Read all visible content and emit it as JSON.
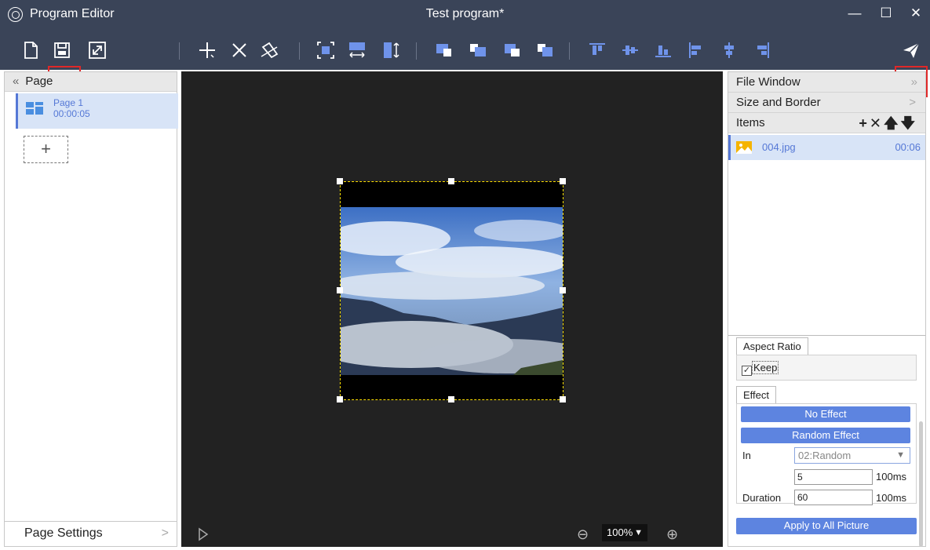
{
  "window": {
    "app_name": "Program Editor",
    "document_title": "Test program*",
    "minimize": "—",
    "maximize": "☐",
    "close": "✕"
  },
  "toolbar": {
    "icons": [
      "new-icon",
      "save-icon",
      "fullscreen-icon",
      "add-window-icon",
      "delete-icon",
      "clear-icon",
      "fit-screen-icon",
      "fit-width-icon",
      "fit-height-icon",
      "bring-front-icon",
      "bring-forward-icon",
      "send-backward-icon",
      "send-back-icon",
      "align-top-icon",
      "align-vcenter-icon",
      "align-bottom-icon",
      "align-left-icon",
      "align-hcenter-icon",
      "align-right-icon",
      "send-icon"
    ],
    "highlight_color": "#e02828"
  },
  "left_panel": {
    "header": "Page",
    "collapse": "«",
    "pages": [
      {
        "name": "Page 1",
        "duration": "00:00:05"
      }
    ],
    "add_page": "+",
    "page_settings": "Page Settings",
    "page_settings_chevron": ">"
  },
  "canvas": {
    "background": "#222222",
    "play": "▷",
    "zoom": "100%",
    "zoom_arrow": "▼",
    "zoom_out": "⊖",
    "zoom_in": "⊕"
  },
  "right_panel": {
    "file_window": "File Window",
    "file_window_chevron": "»",
    "size_border": "Size and Border",
    "size_border_chevron": ">",
    "items_header": "Items",
    "items_tools": "+✕🡅🡇",
    "items": [
      {
        "name": "004.jpg",
        "duration": "00:06"
      }
    ],
    "aspect_ratio_tab": "Aspect Ratio",
    "keep_check": "✓",
    "keep_label": "Keep",
    "effect_tab": "Effect",
    "no_effect": "No Effect",
    "random_effect": "Random Effect",
    "in_label": "In",
    "in_value": "02:Random",
    "in_arrow": "▼",
    "speed_value": "5",
    "speed_unit": "100ms",
    "duration_label": "Duration",
    "duration_value": "60",
    "duration_unit": "100ms",
    "apply_all": "Apply to All Picture"
  },
  "colors": {
    "titlebar": "#3a4458",
    "accent": "#5578d6",
    "button_blue": "#5d84e0",
    "selection_bg": "#d8e4f7"
  }
}
